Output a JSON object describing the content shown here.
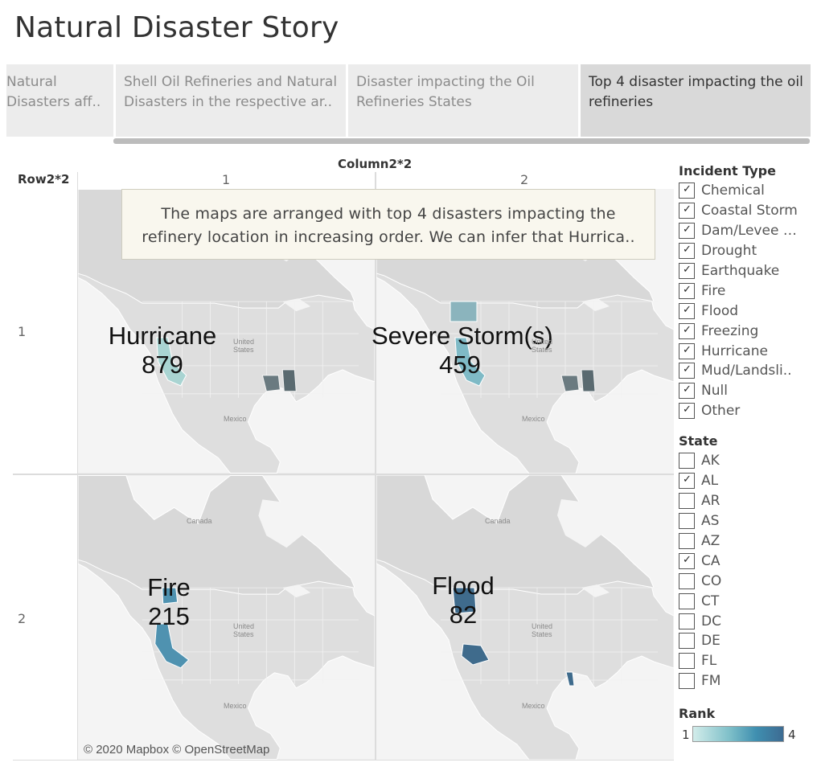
{
  "page": {
    "title": "Natural Disaster Story"
  },
  "story": {
    "tabs": [
      {
        "line1": "Natural",
        "line2": "Disasters aff..",
        "active": false
      },
      {
        "line1": "Shell Oil Refineries and Natural",
        "line2": "Disasters in the respective ar..",
        "active": false
      },
      {
        "line1": "Disaster impacting the Oil",
        "line2": "Refineries States",
        "active": false
      },
      {
        "line1": "Top 4 disaster impacting the oil",
        "line2": "refineries",
        "active": true
      }
    ]
  },
  "grid": {
    "column_title": "Column2*2",
    "row_title": "Row2*2",
    "column_headers": [
      "1",
      "2"
    ],
    "row_headers": [
      "1",
      "2"
    ]
  },
  "caption": {
    "line1": "The maps are arranged with top 4 disasters impacting the",
    "line2": "refinery location in increasing order. We can infer that Hurrica.."
  },
  "maps": [
    {
      "disaster": "Hurricane",
      "count": "879",
      "rank": 1,
      "color": "#a9d4d2"
    },
    {
      "disaster": "Severe Storm(s)",
      "count": "459",
      "rank": 2,
      "color": "#7fbac6"
    },
    {
      "disaster": "Fire",
      "count": "215",
      "rank": 3,
      "color": "#4f92b0"
    },
    {
      "disaster": "Flood",
      "count": "82",
      "rank": 4,
      "color": "#3f6b8c"
    }
  ],
  "map_labels": {
    "country_us": "United\nStates",
    "us_line1": "United",
    "us_line2": "States",
    "mexico": "Mexico",
    "canada": "Canada"
  },
  "attribution": "© 2020 Mapbox © OpenStreetMap",
  "filters": {
    "incident_type": {
      "title": "Incident Type",
      "items": [
        {
          "label": "Chemical",
          "checked": true
        },
        {
          "label": "Coastal Storm",
          "checked": true
        },
        {
          "label": "Dam/Levee B..",
          "checked": true
        },
        {
          "label": "Drought",
          "checked": true
        },
        {
          "label": "Earthquake",
          "checked": true
        },
        {
          "label": "Fire",
          "checked": true
        },
        {
          "label": "Flood",
          "checked": true
        },
        {
          "label": "Freezing",
          "checked": true
        },
        {
          "label": "Hurricane",
          "checked": true
        },
        {
          "label": "Mud/Landsli..",
          "checked": true
        },
        {
          "label": "Null",
          "checked": true
        },
        {
          "label": "Other",
          "checked": true
        }
      ]
    },
    "state": {
      "title": "State",
      "items": [
        {
          "label": "AK",
          "checked": false
        },
        {
          "label": "AL",
          "checked": true
        },
        {
          "label": "AR",
          "checked": false
        },
        {
          "label": "AS",
          "checked": false
        },
        {
          "label": "AZ",
          "checked": false
        },
        {
          "label": "CA",
          "checked": true
        },
        {
          "label": "CO",
          "checked": false
        },
        {
          "label": "CT",
          "checked": false
        },
        {
          "label": "DC",
          "checked": false
        },
        {
          "label": "DE",
          "checked": false
        },
        {
          "label": "FL",
          "checked": false
        },
        {
          "label": "FM",
          "checked": false
        }
      ]
    }
  },
  "legend": {
    "title": "Rank",
    "min": "1",
    "max": "4",
    "color_start": "#d2ecea",
    "color_end": "#3d6b92"
  }
}
